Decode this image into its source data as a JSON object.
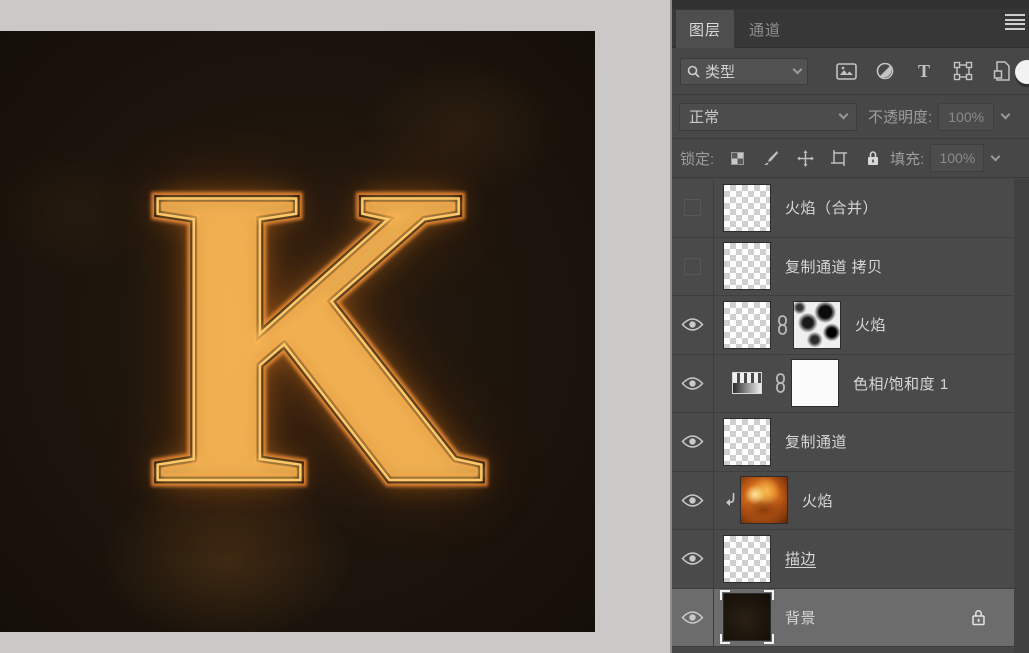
{
  "canvas": {
    "letter": "K",
    "description": "dark brown canvas with fiery glowing outlined letter",
    "glow_color": "#ef9430",
    "background_color": "#1c140c"
  },
  "panel": {
    "tabs": {
      "layers": "图层",
      "channels": "通道"
    },
    "filter": {
      "search_label": "类型",
      "icon_names": [
        "pixel-layer-filter-icon",
        "adjustment-layer-filter-icon",
        "type-layer-filter-icon",
        "shape-layer-filter-icon",
        "smart-object-filter-icon",
        "filter-toggle"
      ]
    },
    "blend": {
      "mode_value": "正常",
      "opacity_label": "不透明度:",
      "opacity_value": "100%"
    },
    "lock": {
      "label": "锁定:",
      "icon_names": [
        "lock-transparent-icon",
        "lock-pixels-icon",
        "lock-position-icon",
        "lock-artboard-icon",
        "lock-all-icon"
      ],
      "fill_label": "填充:",
      "fill_value": "100%"
    },
    "layers": [
      {
        "name": "火焰（合并）",
        "visible": false,
        "thumb": "transparent",
        "selected": false
      },
      {
        "name": "复制通道 拷贝",
        "visible": false,
        "thumb": "transparent",
        "selected": false
      },
      {
        "name": "火焰",
        "visible": true,
        "thumb": "transparent",
        "mask": "clouds",
        "linked": true,
        "selected": false
      },
      {
        "name": "色相/饱和度 1",
        "visible": true,
        "thumb": "adjustment",
        "mask": "white",
        "linked": true,
        "selected": false
      },
      {
        "name": "复制通道",
        "visible": true,
        "thumb": "transparent",
        "selected": false
      },
      {
        "name": "火焰",
        "visible": true,
        "thumb": "fire",
        "clipped": true,
        "selected": false
      },
      {
        "name": "描边",
        "visible": true,
        "thumb": "transparent",
        "selected": false,
        "name_underlined": true
      },
      {
        "name": "背景",
        "visible": true,
        "thumb": "dark",
        "selected": true,
        "locked": true
      }
    ],
    "colors": {
      "panel_bg": "#474747",
      "row_bg": "#4a4a4a",
      "row_selected": "#6c6c6c",
      "text": "#d6d6d6",
      "dim_text": "#8b8b8b"
    }
  }
}
